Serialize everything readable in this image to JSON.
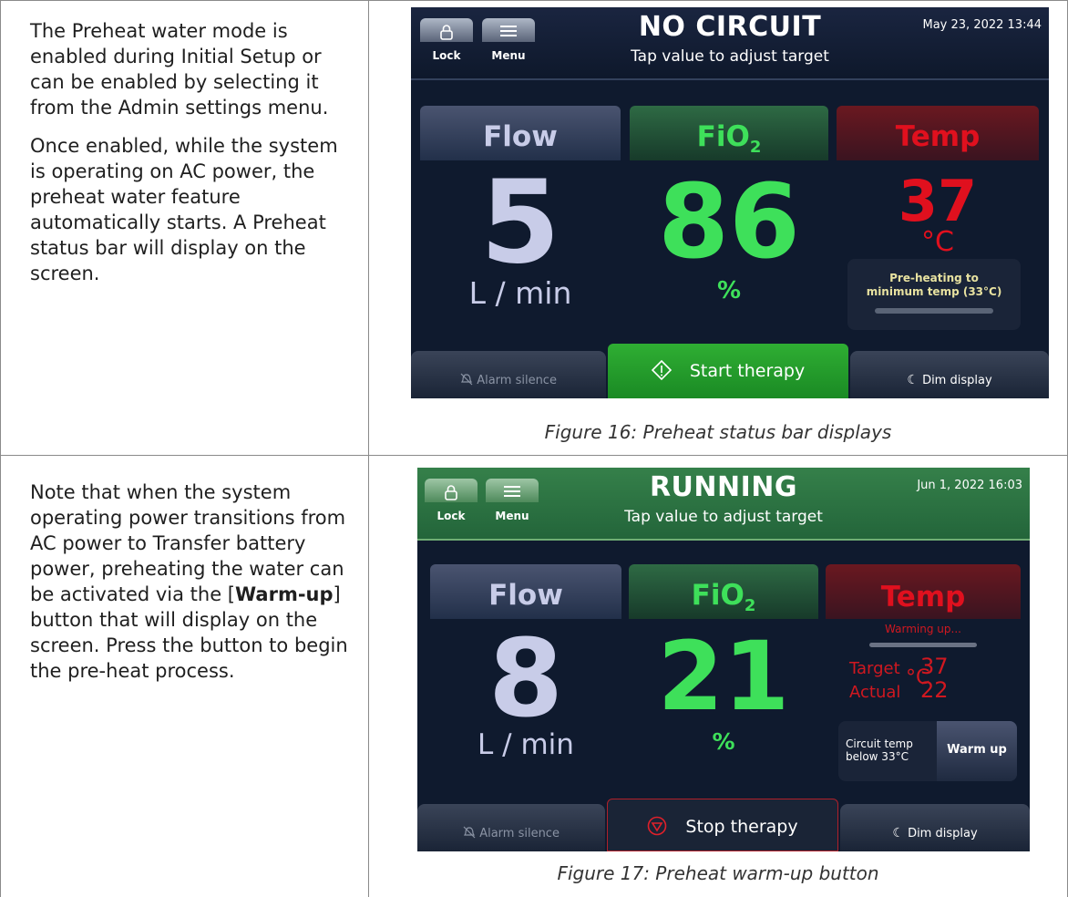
{
  "row1": {
    "paragraphs": [
      "The Preheat water mode is enabled during Initial Setup or can be enabled by selecting it from the Admin settings menu.",
      "Once enabled, while the system is operating on AC power, the preheat water feature automatically starts. A Preheat status bar will display on the screen."
    ],
    "caption": "Figure 16: Preheat status bar displays",
    "screen": {
      "lock_label": "Lock",
      "menu_label": "Menu",
      "status": "NO CIRCUIT",
      "subtitle": "Tap value to adjust target",
      "datetime": "May 23, 2022 13:44",
      "flow_title": "Flow",
      "flow_value": "5",
      "flow_unit": "L / min",
      "fio2_title": "FiO",
      "fio2_sub": "2",
      "fio2_value": "86",
      "fio2_unit": "%",
      "temp_title": "Temp",
      "temp_value": "37",
      "temp_unit": "°C",
      "preheat_line1": "Pre-heating to",
      "preheat_line2": "minimum temp (33°C)",
      "alarm_label": "Alarm silence",
      "start_label": "Start therapy",
      "dim_label": "Dim display"
    }
  },
  "row2": {
    "text_before": "Note that when the system operating power transitions from AC power to Transfer battery power, preheating the water can be activated via the [",
    "text_bold": "Warm-up",
    "text_after": "] button that will display on the screen. Press the button to begin the pre-heat process.",
    "caption": "Figure 17: Preheat warm-up button",
    "screen": {
      "lock_label": "Lock",
      "menu_label": "Menu",
      "status": "RUNNING",
      "subtitle": "Tap value to adjust target",
      "datetime": "Jun 1, 2022 16:03",
      "flow_title": "Flow",
      "flow_value": "8",
      "flow_unit": "L / min",
      "fio2_title": "FiO",
      "fio2_sub": "2",
      "fio2_value": "21",
      "fio2_unit": "%",
      "temp_title": "Temp",
      "warming": "Warming up...",
      "target_label": "Target",
      "target_value": "37",
      "actual_label": "Actual",
      "actual_value": "22",
      "temp_unit": "°C",
      "circuit_line1": "Circuit temp",
      "circuit_line2": "below 33°C",
      "warmup_label": "Warm up",
      "alarm_label": "Alarm silence",
      "stop_label": "Stop therapy",
      "dim_label": "Dim display"
    }
  },
  "colors": {
    "flow": "#c8cce8",
    "fio2": "#3ee05a",
    "temp": "#e0101e",
    "start_green": "#2a9a2e"
  }
}
